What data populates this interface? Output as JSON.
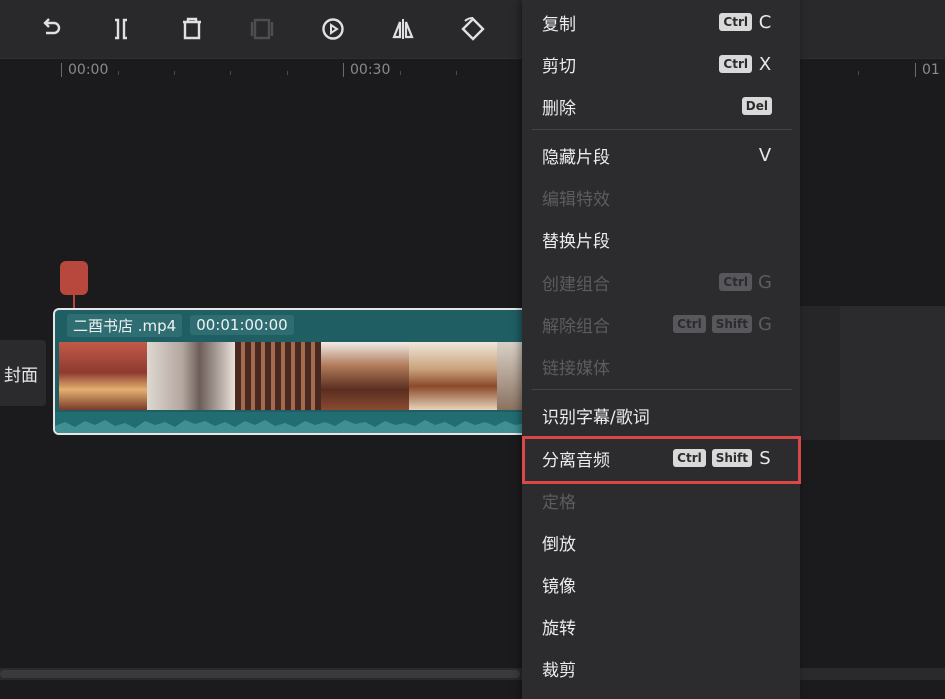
{
  "toolbar": {
    "buttons": [
      {
        "name": "redo",
        "icon": "redo-icon"
      },
      {
        "name": "split",
        "icon": "split-icon"
      },
      {
        "name": "delete",
        "icon": "trash-icon"
      },
      {
        "name": "freeze",
        "icon": "freeze-frame-icon"
      },
      {
        "name": "play-reverse",
        "icon": "play-circle-icon"
      },
      {
        "name": "mirror",
        "icon": "mirror-icon"
      },
      {
        "name": "rotate",
        "icon": "rotate-icon"
      }
    ]
  },
  "ruler": {
    "labels": [
      "00:00",
      "00:30",
      "01"
    ]
  },
  "timeline": {
    "cover_label": "封面",
    "clip": {
      "name": "二酉书店 .mp4",
      "duration": "00:01:00:00"
    }
  },
  "colors": {
    "accent_teal": "#1f5e63",
    "playhead": "#b8483d",
    "highlight": "#d94848"
  },
  "context_menu": {
    "items": [
      {
        "label": "复制",
        "keys": [
          "Ctrl"
        ],
        "letter": "C",
        "enabled": true
      },
      {
        "label": "剪切",
        "keys": [
          "Ctrl"
        ],
        "letter": "X",
        "enabled": true
      },
      {
        "label": "删除",
        "keys": [
          "Del"
        ],
        "letter": "",
        "enabled": true
      },
      {
        "label": "隐藏片段",
        "keys": [],
        "letter": "V",
        "enabled": true
      },
      {
        "label": "编辑特效",
        "keys": [],
        "letter": "",
        "enabled": false
      },
      {
        "label": "替换片段",
        "keys": [],
        "letter": "",
        "enabled": true
      },
      {
        "label": "创建组合",
        "keys": [
          "Ctrl"
        ],
        "letter": "G",
        "enabled": false
      },
      {
        "label": "解除组合",
        "keys": [
          "Ctrl",
          "Shift"
        ],
        "letter": "G",
        "enabled": false
      },
      {
        "label": "链接媒体",
        "keys": [],
        "letter": "",
        "enabled": false
      },
      {
        "label": "识别字幕/歌词",
        "keys": [],
        "letter": "",
        "enabled": true
      },
      {
        "label": "分离音频",
        "keys": [
          "Ctrl",
          "Shift"
        ],
        "letter": "S",
        "enabled": true
      },
      {
        "label": "定格",
        "keys": [],
        "letter": "",
        "enabled": false
      },
      {
        "label": "倒放",
        "keys": [],
        "letter": "",
        "enabled": true
      },
      {
        "label": "镜像",
        "keys": [],
        "letter": "",
        "enabled": true
      },
      {
        "label": "旋转",
        "keys": [],
        "letter": "",
        "enabled": true
      },
      {
        "label": "裁剪",
        "keys": [],
        "letter": "",
        "enabled": true
      }
    ]
  }
}
